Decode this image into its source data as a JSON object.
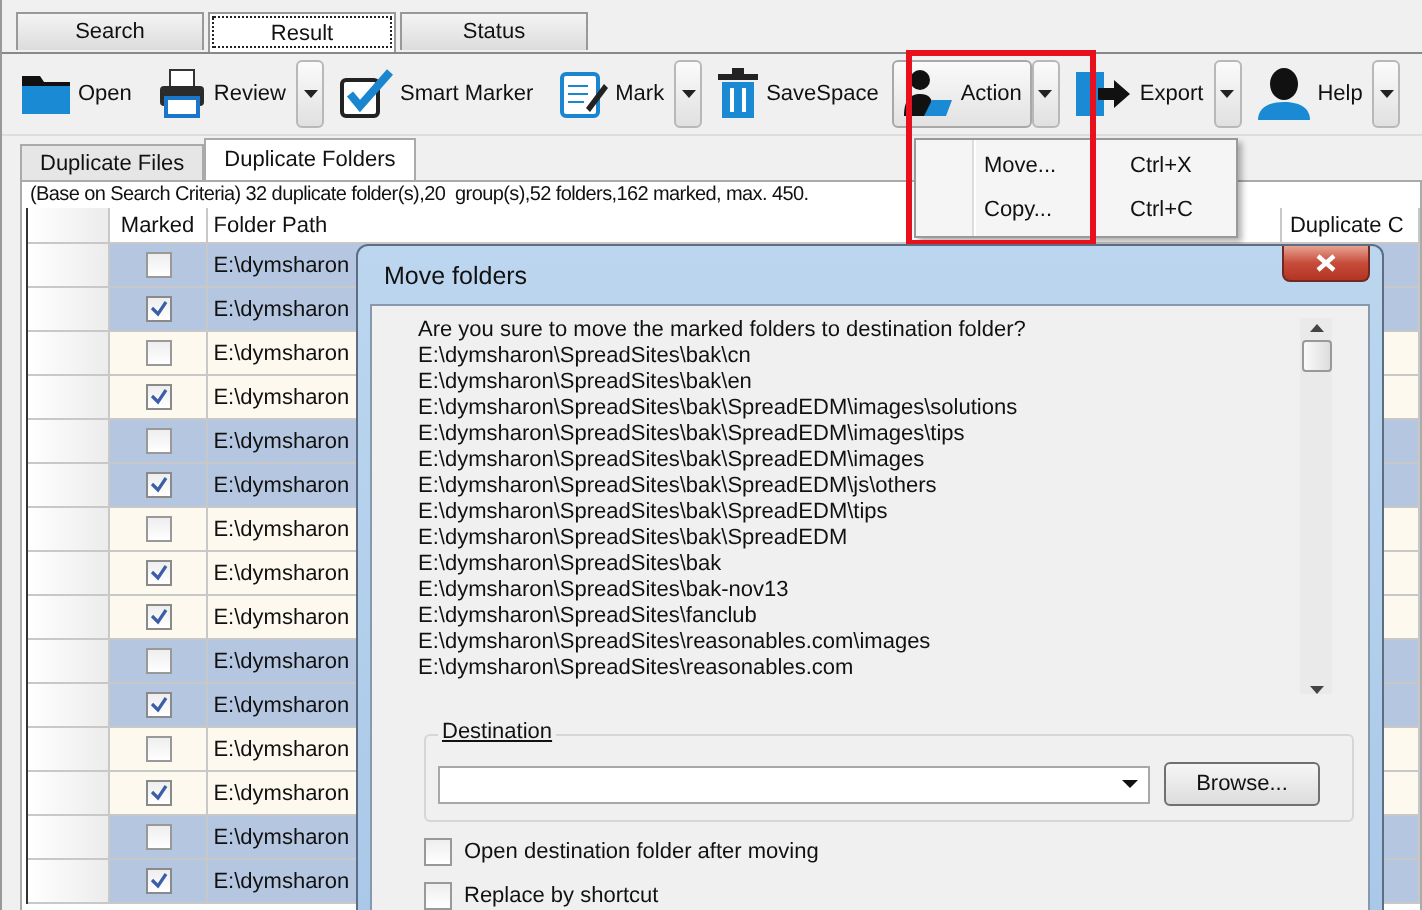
{
  "main_tabs": [
    {
      "label": "Search",
      "selected": false
    },
    {
      "label": "Result",
      "selected": true
    },
    {
      "label": "Status",
      "selected": false
    }
  ],
  "toolbar": [
    {
      "label": "Open",
      "dropdown": false,
      "pressed": false
    },
    {
      "label": "Review",
      "dropdown": true,
      "pressed": false
    },
    {
      "label": "Smart Marker",
      "dropdown": false,
      "pressed": false
    },
    {
      "label": "Mark",
      "dropdown": true,
      "pressed": false
    },
    {
      "label": "SaveSpace",
      "dropdown": false,
      "pressed": false
    },
    {
      "label": "Action",
      "dropdown": true,
      "pressed": true
    },
    {
      "label": "Export",
      "dropdown": true,
      "pressed": false
    },
    {
      "label": "Help",
      "dropdown": true,
      "pressed": false
    }
  ],
  "action_menu": [
    {
      "label": "Move...",
      "shortcut": "Ctrl+X"
    },
    {
      "label": "Copy...",
      "shortcut": "Ctrl+C"
    }
  ],
  "sub_tabs": [
    {
      "label": "Duplicate Files",
      "selected": false
    },
    {
      "label": "Duplicate Folders",
      "selected": true
    }
  ],
  "summary": "(Base on Search Criteria) 32 duplicate folder(s),20  group(s),52 folders,162 marked, max. 450.",
  "table": {
    "columns": [
      "Marked",
      "Folder Path",
      "Duplicate C"
    ],
    "rows": [
      {
        "checked": false,
        "path": "E:\\dymsharon",
        "color": "#b4c6e0"
      },
      {
        "checked": true,
        "path": "E:\\dymsharon",
        "color": "#b4c6e0"
      },
      {
        "checked": false,
        "path": "E:\\dymsharon",
        "color": "#fdf9ee"
      },
      {
        "checked": true,
        "path": "E:\\dymsharon",
        "color": "#fdf9ee"
      },
      {
        "checked": false,
        "path": "E:\\dymsharon",
        "color": "#b4c6e0"
      },
      {
        "checked": true,
        "path": "E:\\dymsharon",
        "color": "#b4c6e0"
      },
      {
        "checked": false,
        "path": "E:\\dymsharon",
        "color": "#fdf9ee"
      },
      {
        "checked": true,
        "path": "E:\\dymsharon",
        "color": "#fdf9ee"
      },
      {
        "checked": true,
        "path": "E:\\dymsharon",
        "color": "#fdf9ee"
      },
      {
        "checked": false,
        "path": "E:\\dymsharon",
        "color": "#b4c6e0"
      },
      {
        "checked": true,
        "path": "E:\\dymsharon",
        "color": "#b4c6e0"
      },
      {
        "checked": false,
        "path": "E:\\dymsharon",
        "color": "#fdf9ee"
      },
      {
        "checked": true,
        "path": "E:\\dymsharon",
        "color": "#fdf9ee"
      },
      {
        "checked": false,
        "path": "E:\\dymsharon",
        "color": "#b4c6e0"
      },
      {
        "checked": true,
        "path": "E:\\dymsharon",
        "color": "#b4c6e0"
      }
    ]
  },
  "dialog": {
    "title": "Move folders",
    "message_lines": [
      "Are you sure to move the marked folders to destination folder?",
      "E:\\dymsharon\\SpreadSites\\bak\\cn",
      "E:\\dymsharon\\SpreadSites\\bak\\en",
      "E:\\dymsharon\\SpreadSites\\bak\\SpreadEDM\\images\\solutions",
      "E:\\dymsharon\\SpreadSites\\bak\\SpreadEDM\\images\\tips",
      "E:\\dymsharon\\SpreadSites\\bak\\SpreadEDM\\images",
      "E:\\dymsharon\\SpreadSites\\bak\\SpreadEDM\\js\\others",
      "E:\\dymsharon\\SpreadSites\\bak\\SpreadEDM\\tips",
      "E:\\dymsharon\\SpreadSites\\bak\\SpreadEDM",
      "E:\\dymsharon\\SpreadSites\\bak",
      "E:\\dymsharon\\SpreadSites\\bak-nov13",
      "E:\\dymsharon\\SpreadSites\\fanclub",
      "E:\\dymsharon\\SpreadSites\\reasonables.com\\images",
      "E:\\dymsharon\\SpreadSites\\reasonables.com"
    ],
    "destination_label": "Destination",
    "browse_button": "Browse...",
    "options": [
      {
        "label": "Open destination folder after moving",
        "checked": false
      },
      {
        "label": "Replace by shortcut",
        "checked": false
      }
    ]
  }
}
